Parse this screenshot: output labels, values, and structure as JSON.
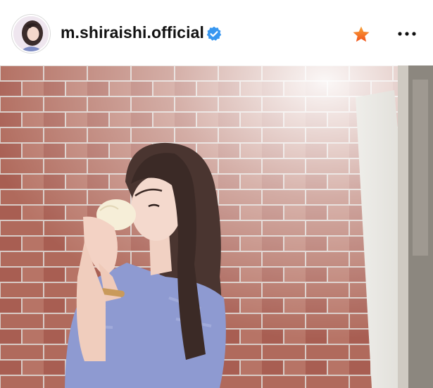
{
  "post_header": {
    "username": "m.shiraishi.official",
    "verified": true
  },
  "colors": {
    "verified_badge": "#3897f0",
    "star": "#f2541b",
    "star_gradient_top": "#f7a33a",
    "text": "#111111"
  },
  "icons": {
    "avatar": "profile-avatar",
    "verified": "verified-badge-icon",
    "favorite": "star-icon",
    "more": "more-options-icon"
  }
}
